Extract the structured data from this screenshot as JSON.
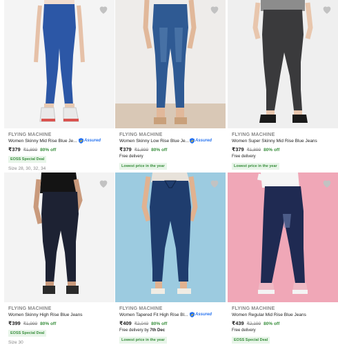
{
  "products": [
    {
      "brand": "FLYING MACHINE",
      "title": "Women Skinny Mid Rise Blue Je...",
      "assured": true,
      "price": "₹379",
      "mrp": "₹1,899",
      "discount": "80% off",
      "delivery": "",
      "badge": "EOSS Special Deal",
      "sizes": "Size 28, 30, 32, 34",
      "bg_color": "#f4f4f4",
      "jeans_color": "#2c57a6"
    },
    {
      "brand": "FLYING MACHINE",
      "title": "Women Skinny Low Rise Blue Je...",
      "assured": true,
      "price": "₹379",
      "mrp": "₹1,899",
      "discount": "80% off",
      "delivery": "Free delivery",
      "badge": "Lowest price in the year",
      "sizes": "",
      "bg_color": "#eeecea",
      "jeans_color": "#2f5a93"
    },
    {
      "brand": "FLYING MACHINE",
      "title": "Women Super Skinny Mid Rise Blue Jeans",
      "assured": false,
      "price": "₹379",
      "mrp": "₹1,899",
      "discount": "80% off",
      "delivery": "Free delivery",
      "badge": "Lowest price in the year",
      "sizes": "",
      "bg_color": "#efefef",
      "jeans_color": "#3a3a3c"
    },
    {
      "brand": "FLYING MACHINE",
      "title": "Women Skinny High Rise Blue Jeans",
      "assured": false,
      "price": "₹399",
      "mrp": "₹1,999",
      "discount": "80% off",
      "delivery": "",
      "badge": "EOSS Special Deal",
      "sizes": "Size 30",
      "bg_color": "#f3f3f3",
      "jeans_color": "#1d2233"
    },
    {
      "brand": "FLYING MACHINE",
      "title": "Women Tapered Fit High Rise Bl...",
      "assured": true,
      "price": "₹409",
      "mrp": "₹2,049",
      "discount": "80% off",
      "delivery_prefix": "Free delivery by ",
      "delivery_date": "7th Dec",
      "badge": "Lowest price in the year",
      "sizes": "",
      "bg_color": "#9ccbe0",
      "jeans_color": "#1f3d6e"
    },
    {
      "brand": "FLYING MACHINE",
      "title": "Women Regular Mid Rise Blue Jeans",
      "assured": false,
      "price": "₹439",
      "mrp": "₹2,199",
      "discount": "80% off",
      "delivery": "Free delivery",
      "badge": "EOSS Special Deal",
      "sizes": "",
      "bg_color": "#f0a7b7",
      "jeans_color": "#1f2a52"
    }
  ],
  "assured_label": "Assured",
  "colors": {
    "brand_gray": "#878787",
    "discount_green": "#388e3c",
    "assured_blue": "#2874f0",
    "badge_bg": "#e8f5e9"
  },
  "icons": {
    "wishlist": "heart-icon",
    "assured": "shield-icon"
  }
}
